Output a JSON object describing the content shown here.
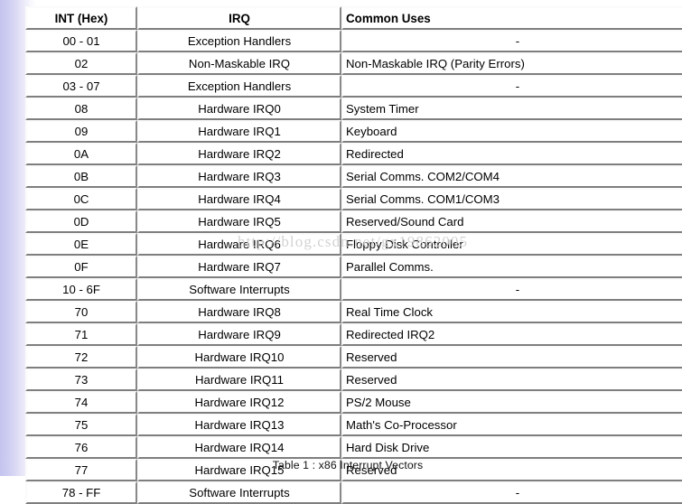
{
  "table": {
    "caption": "Table 1 : x86 Interrupt Vectors",
    "columns": [
      {
        "key": "int_hex",
        "label": "INT (Hex)",
        "align": "center"
      },
      {
        "key": "irq",
        "label": "IRQ",
        "align": "center"
      },
      {
        "key": "common_uses",
        "label": "Common Uses",
        "align": "left"
      }
    ],
    "rows": [
      {
        "int_hex": "00 - 01",
        "irq": "Exception Handlers",
        "common_uses": "-",
        "uses_align": "center"
      },
      {
        "int_hex": "02",
        "irq": "Non-Maskable IRQ",
        "common_uses": "Non-Maskable IRQ (Parity Errors)",
        "uses_align": "left"
      },
      {
        "int_hex": "03 - 07",
        "irq": "Exception Handlers",
        "common_uses": "-",
        "uses_align": "center"
      },
      {
        "int_hex": "08",
        "irq": "Hardware IRQ0",
        "common_uses": "System Timer",
        "uses_align": "left"
      },
      {
        "int_hex": "09",
        "irq": "Hardware IRQ1",
        "common_uses": "Keyboard",
        "uses_align": "left"
      },
      {
        "int_hex": "0A",
        "irq": "Hardware IRQ2",
        "common_uses": "Redirected",
        "uses_align": "left"
      },
      {
        "int_hex": "0B",
        "irq": "Hardware IRQ3",
        "common_uses": "Serial Comms. COM2/COM4",
        "uses_align": "left"
      },
      {
        "int_hex": "0C",
        "irq": "Hardware IRQ4",
        "common_uses": "Serial Comms. COM1/COM3",
        "uses_align": "left"
      },
      {
        "int_hex": "0D",
        "irq": "Hardware IRQ5",
        "common_uses": "Reserved/Sound Card",
        "uses_align": "left"
      },
      {
        "int_hex": "0E",
        "irq": "Hardware IRQ6",
        "common_uses": "Floppy Disk Controller",
        "uses_align": "left"
      },
      {
        "int_hex": "0F",
        "irq": "Hardware IRQ7",
        "common_uses": "Parallel Comms.",
        "uses_align": "left"
      },
      {
        "int_hex": "10 - 6F",
        "irq": "Software Interrupts",
        "common_uses": "-",
        "uses_align": "center"
      },
      {
        "int_hex": "70",
        "irq": "Hardware IRQ8",
        "common_uses": "Real Time Clock",
        "uses_align": "left"
      },
      {
        "int_hex": "71",
        "irq": "Hardware IRQ9",
        "common_uses": "Redirected IRQ2",
        "uses_align": "left"
      },
      {
        "int_hex": "72",
        "irq": "Hardware IRQ10",
        "common_uses": "Reserved",
        "uses_align": "left"
      },
      {
        "int_hex": "73",
        "irq": "Hardware IRQ11",
        "common_uses": "Reserved",
        "uses_align": "left"
      },
      {
        "int_hex": "74",
        "irq": "Hardware IRQ12",
        "common_uses": "PS/2 Mouse",
        "uses_align": "left"
      },
      {
        "int_hex": "75",
        "irq": "Hardware IRQ13",
        "common_uses": "Math's Co-Processor",
        "uses_align": "left"
      },
      {
        "int_hex": "76",
        "irq": "Hardware IRQ14",
        "common_uses": "Hard Disk Drive",
        "uses_align": "left"
      },
      {
        "int_hex": "77",
        "irq": "Hardware IRQ15",
        "common_uses": "Reserved",
        "uses_align": "left"
      },
      {
        "int_hex": "78 - FF",
        "irq": "Software Interrupts",
        "common_uses": "-",
        "uses_align": "center"
      }
    ]
  },
  "watermark": {
    "text": "http://blog.csdn.net/gx19862005"
  },
  "colors": {
    "gradient_start": "#c4c4ef",
    "gradient_end": "#ffffff",
    "cell_border": "#f3f3f3",
    "text": "#000000",
    "watermark": "#cfcfcf"
  }
}
